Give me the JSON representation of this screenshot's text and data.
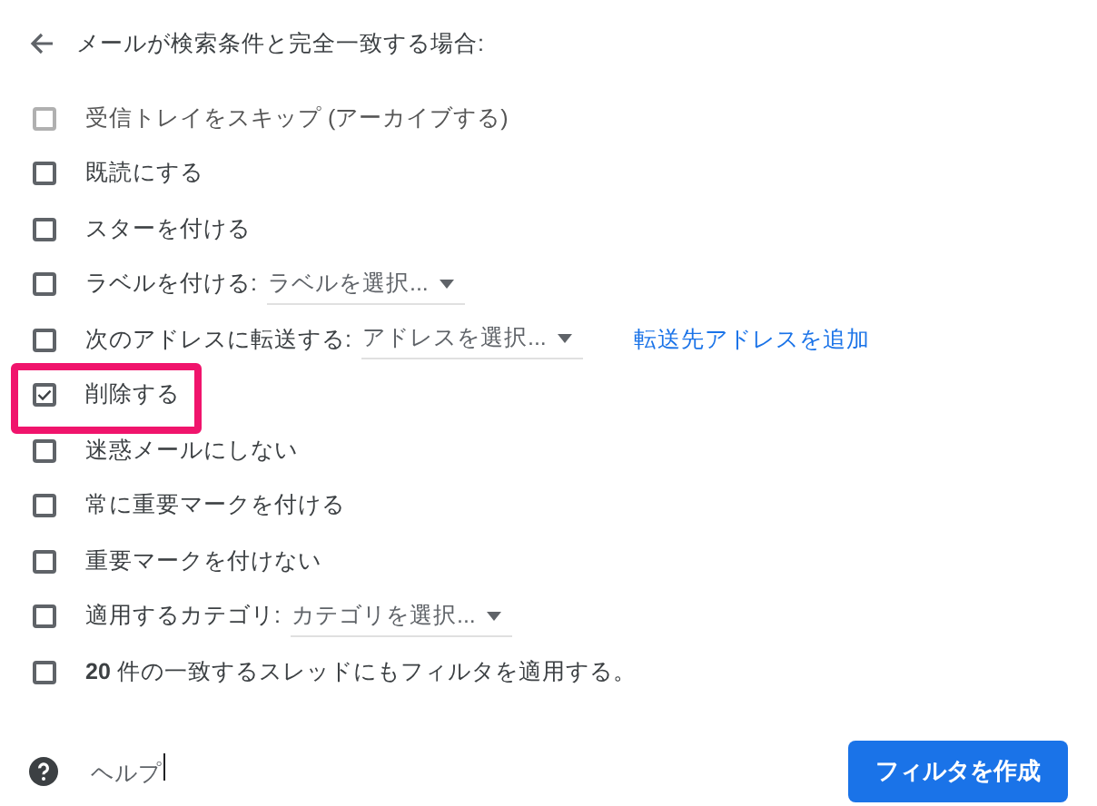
{
  "header": {
    "title": "メールが検索条件と完全一致する場合:"
  },
  "actions": [
    {
      "kind": "plain",
      "label": "受信トレイをスキップ (アーカイブする)",
      "checked": false,
      "disabled": true,
      "highlighted": false
    },
    {
      "kind": "plain",
      "label": "既読にする",
      "checked": false,
      "disabled": false,
      "highlighted": false
    },
    {
      "kind": "plain",
      "label": "スターを付ける",
      "checked": false,
      "disabled": false,
      "highlighted": false
    },
    {
      "kind": "select",
      "label": "ラベルを付ける:",
      "select": "ラベルを選択...",
      "checked": false,
      "disabled": false,
      "highlighted": false
    },
    {
      "kind": "select",
      "label": "次のアドレスに転送する:",
      "select": "アドレスを選択...",
      "link": "転送先アドレスを追加",
      "checked": false,
      "disabled": false,
      "highlighted": false
    },
    {
      "kind": "plain",
      "label": "削除する",
      "checked": true,
      "disabled": false,
      "highlighted": true
    },
    {
      "kind": "plain",
      "label": "迷惑メールにしない",
      "checked": false,
      "disabled": false,
      "highlighted": false
    },
    {
      "kind": "plain",
      "label": "常に重要マークを付ける",
      "checked": false,
      "disabled": false,
      "highlighted": false
    },
    {
      "kind": "plain",
      "label": "重要マークを付けない",
      "checked": false,
      "disabled": false,
      "highlighted": false
    },
    {
      "kind": "select",
      "label": "適用するカテゴリ:",
      "select": "カテゴリを選択...",
      "checked": false,
      "disabled": false,
      "highlighted": false
    },
    {
      "kind": "plain",
      "label": "**20** 件の一致するスレッドにもフィルタを適用する。",
      "checked": false,
      "disabled": false,
      "highlighted": false
    }
  ],
  "footer": {
    "help": "ヘルプ",
    "button": "フィルタを作成"
  }
}
